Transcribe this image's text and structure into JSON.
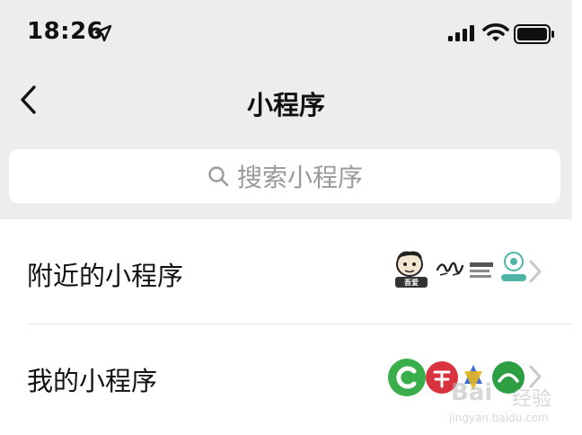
{
  "status_bar": {
    "time": "18:26",
    "icons": [
      "location-arrow-icon",
      "cellular-signal-icon",
      "wifi-icon",
      "battery-icon"
    ]
  },
  "nav": {
    "back_icon": "chevron-left-icon",
    "title": "小程序"
  },
  "search": {
    "placeholder": "搜索小程序",
    "icon": "search-icon"
  },
  "list": {
    "items": [
      {
        "label": "附近的小程序",
        "thumbnails": [
          "cartoon-logo",
          "calligraphy-logo",
          "text-logo",
          "teal-logo"
        ]
      },
      {
        "label": "我的小程序",
        "thumbnails": [
          "green-c-logo",
          "red-logo",
          "star-logo",
          "green-logo"
        ]
      }
    ]
  },
  "watermark": {
    "line1": "Bai",
    "line2": "经验",
    "url": "jingyan.baidu.com"
  },
  "colors": {
    "background_top": "#ededed",
    "background_list": "#ffffff",
    "text": "#111111",
    "placeholder": "#9a9a9a",
    "chevron": "#c7c7cc"
  }
}
